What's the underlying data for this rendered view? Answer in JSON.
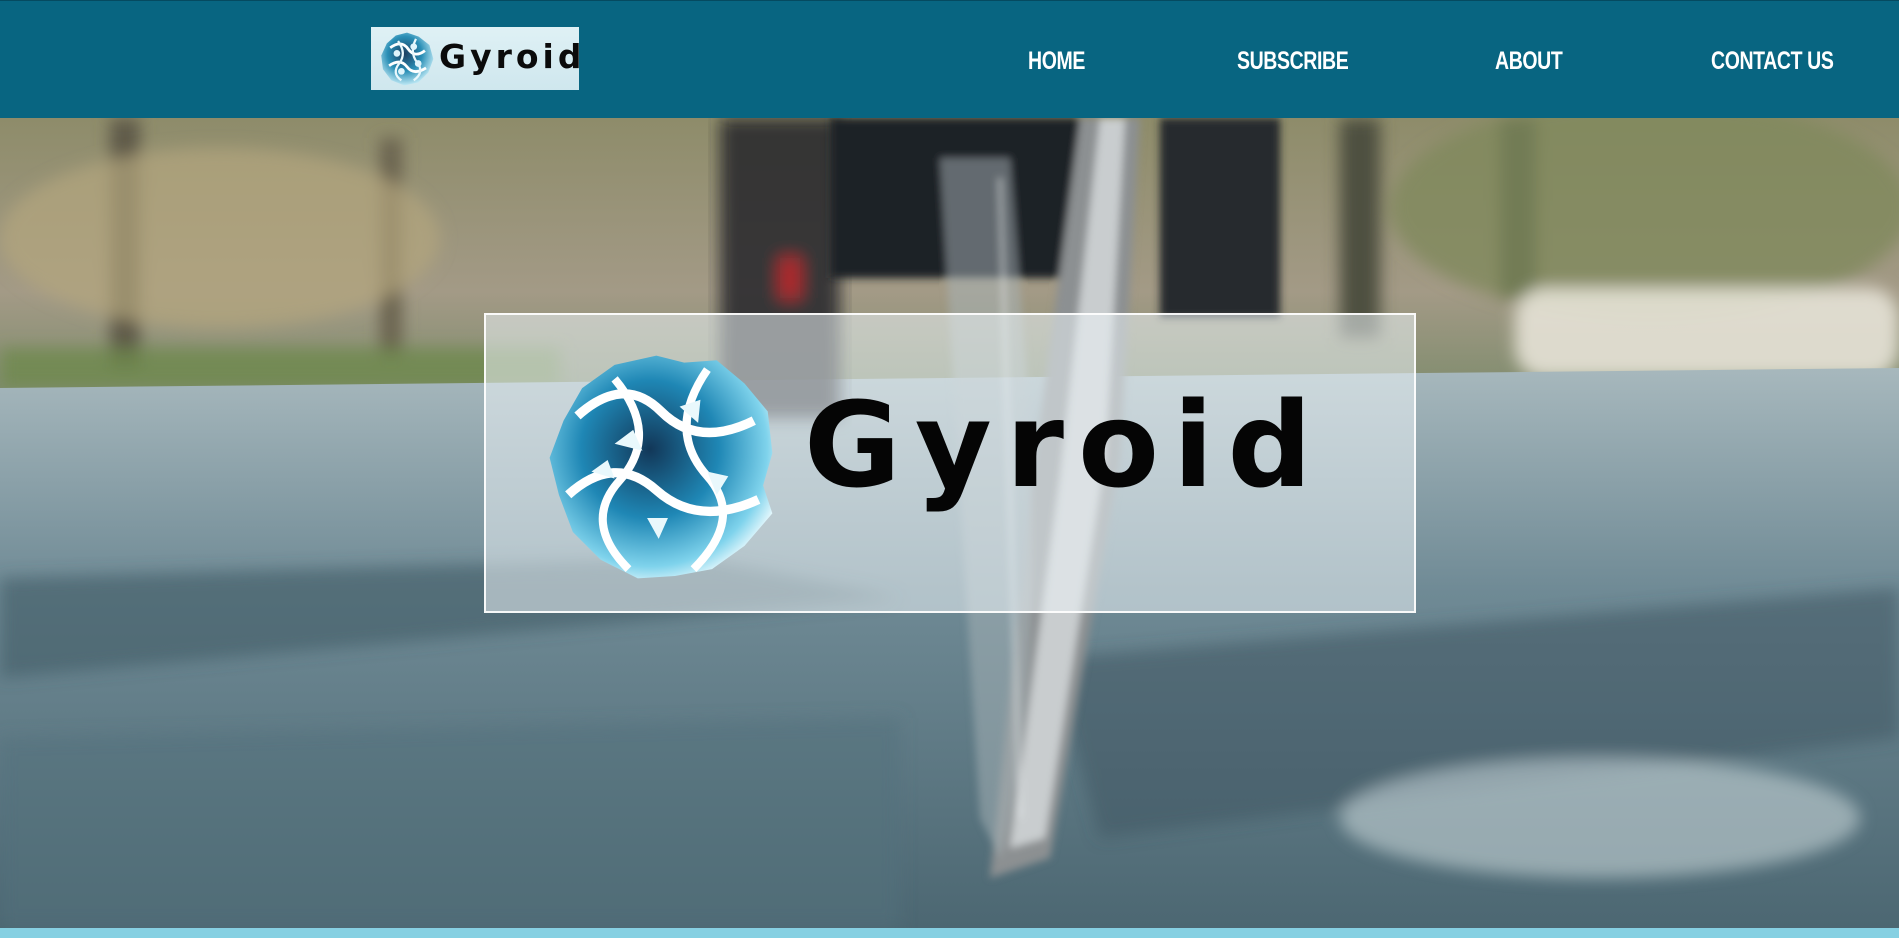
{
  "header": {
    "logo_text": "Gyroid",
    "nav": [
      {
        "label": "HOME"
      },
      {
        "label": "SUBSCRIBE"
      },
      {
        "label": "ABOUT"
      },
      {
        "label": "CONTACT US"
      }
    ]
  },
  "hero": {
    "logo_text": "Gyroid",
    "background_image": "cyclist-wheel-on-road-photo"
  },
  "colors": {
    "header_bg": "#086581",
    "accent_strip": "#86d0e2",
    "nav_text": "#ffffff"
  }
}
